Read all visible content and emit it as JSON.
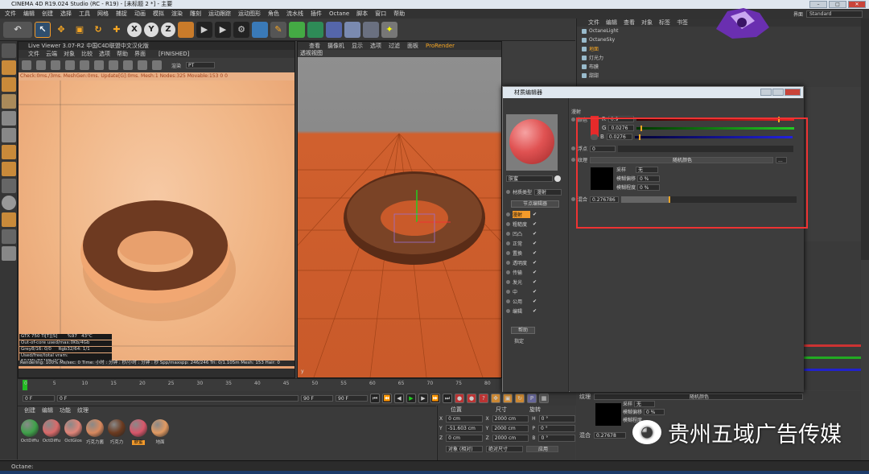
{
  "window": {
    "title": "CINEMA 4D R19.024 Studio (RC - R19) - [未标题 2 *] - 主要"
  },
  "menu": [
    "文件",
    "编辑",
    "创建",
    "选择",
    "工具",
    "网格",
    "捕捉",
    "动画",
    "模拟",
    "渲染",
    "雕刻",
    "运动跟踪",
    "运动图形",
    "角色",
    "流水线",
    "插件",
    "Octane",
    "脚本",
    "窗口",
    "帮助"
  ],
  "layout": {
    "label": "界面",
    "value": "Standard"
  },
  "main_toolbar": {
    "axis_x": "X",
    "axis_y": "Y",
    "axis_z": "Z"
  },
  "live_viewer": {
    "title": "Live Viewer 3.07-R2 中国C4D联盟中文汉化版",
    "menu": [
      "文件",
      "云端",
      "对象",
      "比较",
      "选项",
      "帮助",
      "界面"
    ],
    "finished": "[FINISHED]",
    "mode_label": "渲染",
    "mode_value": "PT",
    "status": "Check:0ms./3ms. MeshGen:0ms. Update[G]:0ms. Mesh:1 Nodes:325 Movable:153  0 0",
    "gpu": {
      "name": "GTX 750 Ti[T][S]",
      "pct": "%97",
      "temp": "43°C"
    },
    "outofcore": "Out-of-core used/max:0Kb/4Gb",
    "grey": "Grey8/16: 0/0",
    "rgb": "Rgb32/64: 1/1",
    "vram": "Used/free/total vram: 594Mb/861Mb/2Gb",
    "render_line": "Rendering: 100%   Ms/sec: 0   Time: 小时 : 分钟 : 秒/小时 : 分钟 : 秒   Spp/maxspp: 246/246   Tri: 0/1.105m  Mesh: 153  Hair: 0"
  },
  "perspective": {
    "menu": [
      "查看",
      "摄像机",
      "显示",
      "选项",
      "过滤",
      "面板",
      "ProRender"
    ],
    "label": "透视视图"
  },
  "object_manager": {
    "menu": [
      "文件",
      "编辑",
      "查看",
      "对象",
      "标签",
      "书签"
    ],
    "items": [
      "OctaneLight",
      "OctaneSky",
      "地面",
      "灯光力",
      "布膜",
      "甜甜"
    ]
  },
  "material_editor": {
    "title": "材质编辑器",
    "mat_name": "肤蜜",
    "type_label": "材质类型",
    "type_value": "漫射",
    "node_btn": "节点编辑器",
    "channels": [
      "漫射",
      "粗糙度",
      "凹凸",
      "正常",
      "置换",
      "透明度",
      "传输",
      "发光",
      "中",
      "公用",
      "编辑"
    ],
    "help": "帮助",
    "assign": "指定",
    "section": "漫射",
    "color_label": "颜色",
    "r_label": "R",
    "r_value": "0.9",
    "g_label": "G",
    "g_value": "0.0276",
    "b_label": "B",
    "b_value": "0.0276",
    "float_label": "浮点",
    "float_value": "0",
    "texture_label": "纹理",
    "texture_btn": "随机颜色",
    "sub_rows": [
      {
        "label": "采样",
        "value": "无"
      },
      {
        "label": "模糊偏移",
        "value": "0 %"
      },
      {
        "label": "模糊程度",
        "value": "0 %"
      }
    ],
    "mix_label": "混合",
    "mix_value": "0.276786"
  },
  "timeline": {
    "ticks": [
      "0",
      "5",
      "10",
      "15",
      "20",
      "25",
      "30",
      "35",
      "40",
      "45",
      "50",
      "55",
      "60",
      "65",
      "70",
      "75",
      "80"
    ],
    "start": "0 F",
    "current": "0 F",
    "end": "90 F",
    "end2": "90 F"
  },
  "material_manager": {
    "menu": [
      "创建",
      "编辑",
      "功能",
      "纹理"
    ],
    "materials": [
      {
        "name": "OctDiffu",
        "color": "#3fa14a"
      },
      {
        "name": "OctDiffu",
        "color": "#d96a6a"
      },
      {
        "name": "OctGlos",
        "color": "#e08478"
      },
      {
        "name": "巧克力酱",
        "color": "#d9895e"
      },
      {
        "name": "巧克力",
        "color": "#6b3a1f"
      },
      {
        "name": "肤蜜",
        "color": "#d9566a",
        "selected": true
      },
      {
        "name": "地面",
        "color": "#e19a62"
      }
    ]
  },
  "coords": {
    "headers": [
      "位置",
      "尺寸",
      "旋转"
    ],
    "rows": [
      {
        "axis": "X",
        "pos": "0 cm",
        "size": "2000 cm",
        "rot_axis": "H",
        "rot": "0 °"
      },
      {
        "axis": "Y",
        "pos": "-51.603 cm",
        "size": "2000 cm",
        "rot_axis": "P",
        "rot": "0 °"
      },
      {
        "axis": "Z",
        "pos": "0 cm",
        "size": "2000 cm",
        "rot_axis": "B",
        "rot": "0 °"
      }
    ],
    "mode1": "对象 (相对)",
    "mode2": "绝对尺寸",
    "apply": "应用"
  },
  "lower_attr": {
    "texture_label": "纹理",
    "texture_btn": "随机颜色",
    "rows": [
      {
        "label": "采样",
        "value": "无"
      },
      {
        "label": "模糊偏移",
        "value": "0 %"
      },
      {
        "label": "模糊程度",
        "value": "0 %"
      }
    ],
    "mix_label": "混合",
    "mix_value": "0.27678"
  },
  "statusbar": "Octane:",
  "watermark": "贵州五域广告传媒"
}
